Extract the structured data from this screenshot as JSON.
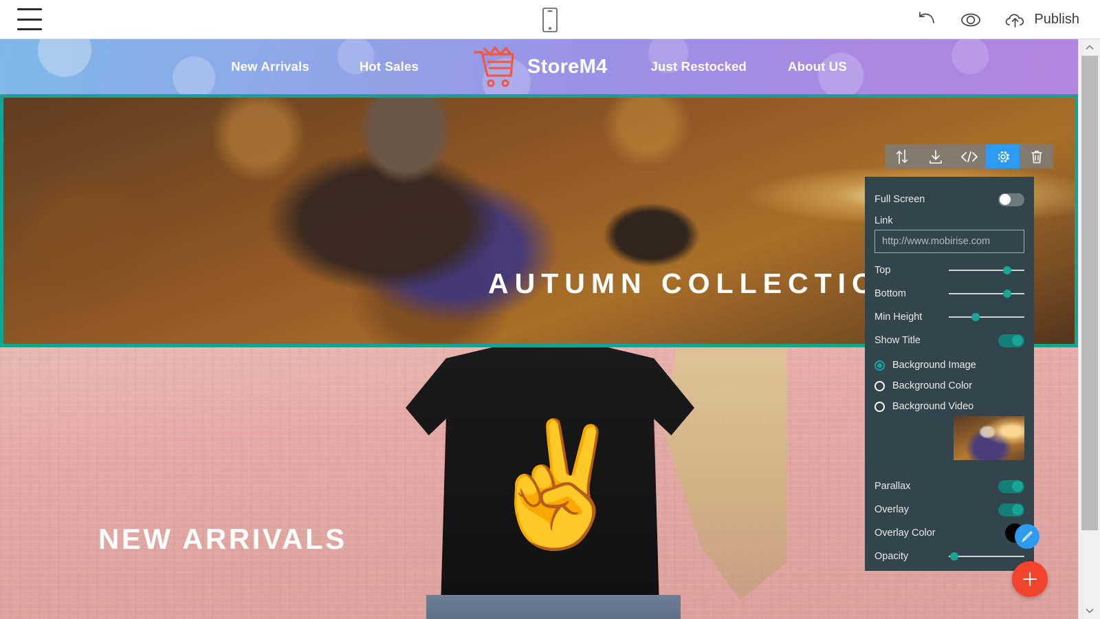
{
  "topbar": {
    "menu_icon": "hamburger-menu-icon",
    "device_icon": "mobile-phone-icon",
    "undo_icon": "undo-arrow-icon",
    "preview_icon": "eye-preview-icon",
    "publish_icon": "cloud-upload-icon",
    "publish_label": "Publish"
  },
  "navbar": {
    "brand_name": "StoreM4",
    "cart_icon": "shopping-cart-icon",
    "links_left": [
      "New Arrivals",
      "Hot Sales"
    ],
    "links_right": [
      "Just Restocked",
      "About US"
    ]
  },
  "hero": {
    "title": "AUTUMN COLLECTION",
    "selected": true,
    "selection_color": "#15a394"
  },
  "block2": {
    "title": "NEW ARRIVALS"
  },
  "block_toolbar": {
    "buttons": [
      {
        "name": "move-block-icon",
        "glyph": "move-up-down"
      },
      {
        "name": "download-block-icon",
        "glyph": "download"
      },
      {
        "name": "code-editor-icon",
        "glyph": "</>"
      },
      {
        "name": "block-settings-icon",
        "glyph": "gear",
        "active": true
      },
      {
        "name": "delete-block-icon",
        "glyph": "trash"
      }
    ],
    "active_color": "#2e9bf0"
  },
  "settings_panel": {
    "full_screen": {
      "label": "Full Screen",
      "value": false
    },
    "link": {
      "label": "Link",
      "placeholder": "http://www.mobirise.com",
      "value": ""
    },
    "sliders": [
      {
        "label": "Top",
        "percent": 72
      },
      {
        "label": "Bottom",
        "percent": 72
      },
      {
        "label": "Min Height",
        "percent": 30
      }
    ],
    "show_title": {
      "label": "Show Title",
      "value": true
    },
    "background_type": {
      "options": [
        "Background Image",
        "Background Color",
        "Background Video"
      ],
      "selected": "Background Image"
    },
    "thumbnail": "background-image-thumbnail",
    "parallax": {
      "label": "Parallax",
      "value": true
    },
    "overlay": {
      "label": "Overlay",
      "value": true
    },
    "overlay_color": {
      "label": "Overlay Color",
      "value": "#000000"
    },
    "opacity": {
      "label": "Opacity",
      "percent": 2
    },
    "accent_color": "#16a596",
    "panel_bg": "#34444c"
  },
  "fabs": {
    "pen": {
      "name": "edit-pen-fab",
      "color": "#2e9bf0"
    },
    "add": {
      "name": "add-block-fab",
      "glyph": "+",
      "color": "#f2432c"
    }
  },
  "scrollbar": {
    "up_arrow": "scroll-up-arrow",
    "down_arrow": "scroll-down-arrow"
  }
}
